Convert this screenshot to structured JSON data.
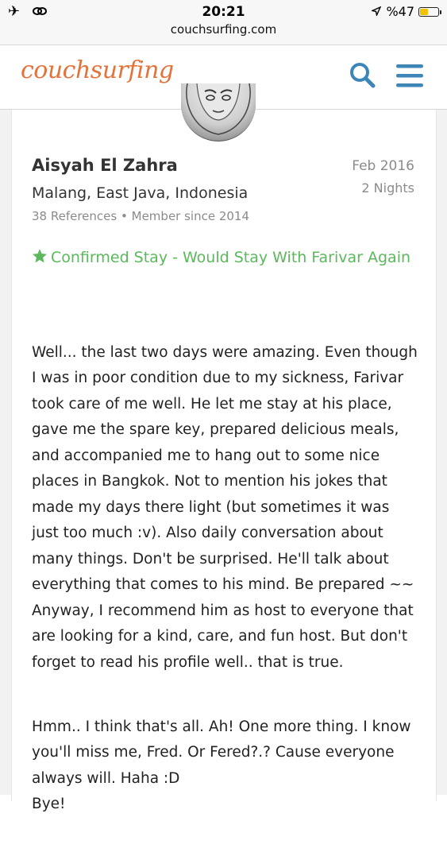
{
  "status_bar": {
    "time": "20:21",
    "url": "couchsurfing.com",
    "battery_text": "%47",
    "battery_level": 0.47,
    "left_icons": [
      "airplane-icon",
      "link-icon"
    ],
    "location_icon": "location-arrow-icon"
  },
  "header": {
    "logo_text": "couchsurfing",
    "search_icon": "search-icon",
    "menu_icon": "hamburger-menu-icon",
    "accent_color": "#3f86b8",
    "logo_color": "#e2733b"
  },
  "reference": {
    "author_name": "Aisyah El Zahra",
    "author_location": "Malang, East Java, Indonesia",
    "references_count": "38 References",
    "member_since": "Member since 2014",
    "separator": "•",
    "date": "Feb 2016",
    "nights": "2 Nights",
    "confirmed_text": "Confirmed Stay - Would Stay With Farivar Again",
    "confirmed_color": "#5cb85c",
    "paragraphs": [
      "Well... the last two days were amazing. Even though I was in poor condition due to my sickness, Farivar took care of me well. He let me stay at his place, gave me the spare key, prepared delicious meals, and accompanied me to hang out to some nice places in Bangkok. Not to mention his jokes that made my days there light (but sometimes it was just too much :v). Also daily conversation about many things. Don't be surprised. He'll talk about everything that comes to his mind. Be prepared ~~\nAnyway, I recommend him as host to everyone that are looking for a kind, care, and fun host. But don't forget to read his profile well.. that is true.",
      "Hmm.. I think that's all. Ah! One more thing. I know you'll miss me, Fred. Or Fered?.? Cause everyone always will. Haha :D\nBye!"
    ]
  }
}
